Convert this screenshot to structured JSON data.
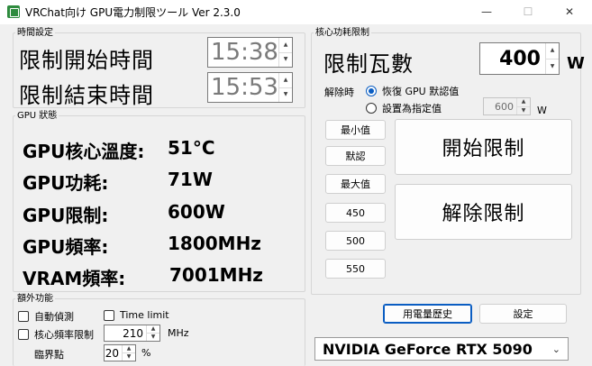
{
  "window": {
    "title": "VRChat向け GPU電力制限ツール Ver 2.3.0",
    "min_glyph": "—",
    "max_glyph": "☐",
    "close_glyph": "✕"
  },
  "time_settings": {
    "legend": "時間設定",
    "start_label": "限制開始時間",
    "start_value": "15:38",
    "end_label": "限制結束時間",
    "end_value": "15:53"
  },
  "gpu_status": {
    "legend": "GPU 狀態",
    "rows": [
      {
        "label": "GPU核心溫度:",
        "value": "51°C"
      },
      {
        "label": "GPU功耗:",
        "value": "71W"
      },
      {
        "label": "GPU限制:",
        "value": "600W"
      },
      {
        "label": "GPU頻率:",
        "value": "1800MHz"
      },
      {
        "label": "VRAM頻率:",
        "value": "7001MHz"
      }
    ]
  },
  "extra": {
    "legend": "額外功能",
    "auto_detect_label": "自動偵測",
    "auto_detect_checked": false,
    "time_limit_label": "Time limit",
    "time_limit_checked": false,
    "core_freq_label": "核心頻率限制",
    "core_freq_checked": false,
    "core_freq_value": "210",
    "core_freq_unit": "MHz",
    "threshold_label": "臨界點",
    "threshold_value": "20",
    "threshold_unit": "%"
  },
  "power_limit": {
    "legend": "核心功耗限制",
    "watt_label": "限制瓦數",
    "watt_value": "400",
    "watt_unit": "W",
    "release_label": "解除時",
    "restore_default_label": "恢復 GPU 默認值",
    "restore_default_selected": true,
    "set_specified_label": "設置為指定值",
    "set_specified_selected": false,
    "specified_value": "600",
    "specified_unit": "W",
    "preset_buttons": [
      "最小值",
      "默認",
      "最大值",
      "450",
      "500",
      "550"
    ],
    "start_button": "開始限制",
    "stop_button": "解除限制"
  },
  "footer": {
    "history_button": "用電量歷史",
    "settings_button": "設定",
    "gpu_select_value": "NVIDIA GeForce RTX 5090"
  },
  "colors": {
    "accent": "#0a5dc2",
    "background": "#f0f0f0"
  }
}
